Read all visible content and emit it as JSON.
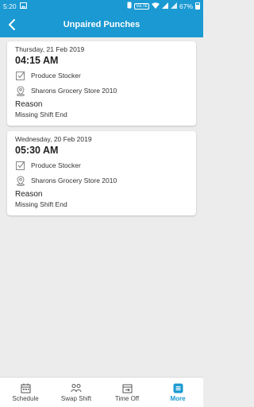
{
  "status_bar": {
    "time": "5:20",
    "network_badge": "VoLTE",
    "battery": "67%",
    "icons": [
      "image-icon",
      "phone-icon",
      "wifi-icon",
      "signal-icon",
      "battery-icon"
    ]
  },
  "header": {
    "title": "Unpaired Punches",
    "back_icon": "chevron-left-icon"
  },
  "cards": [
    {
      "date": "Thursday, 21 Feb 2019",
      "time": "04:15 AM",
      "position": "Produce Stocker",
      "location": "Sharons Grocery Store 2010",
      "reason_label": "Reason",
      "reason": "Missing Shift End"
    },
    {
      "date": "Wednesday, 20 Feb 2019",
      "time": "05:30 AM",
      "position": "Produce Stocker",
      "location": "Sharons Grocery Store 2010",
      "reason_label": "Reason",
      "reason": "Missing Shift End"
    }
  ],
  "bottom_nav": {
    "items": [
      {
        "label": "Schedule",
        "icon": "calendar-icon"
      },
      {
        "label": "Swap Shift",
        "icon": "swap-icon"
      },
      {
        "label": "Time Off",
        "icon": "time-off-icon"
      },
      {
        "label": "More",
        "icon": "more-icon",
        "active": true
      }
    ]
  },
  "colors": {
    "primary": "#1a99d2",
    "background": "#ececec",
    "card": "#ffffff"
  }
}
